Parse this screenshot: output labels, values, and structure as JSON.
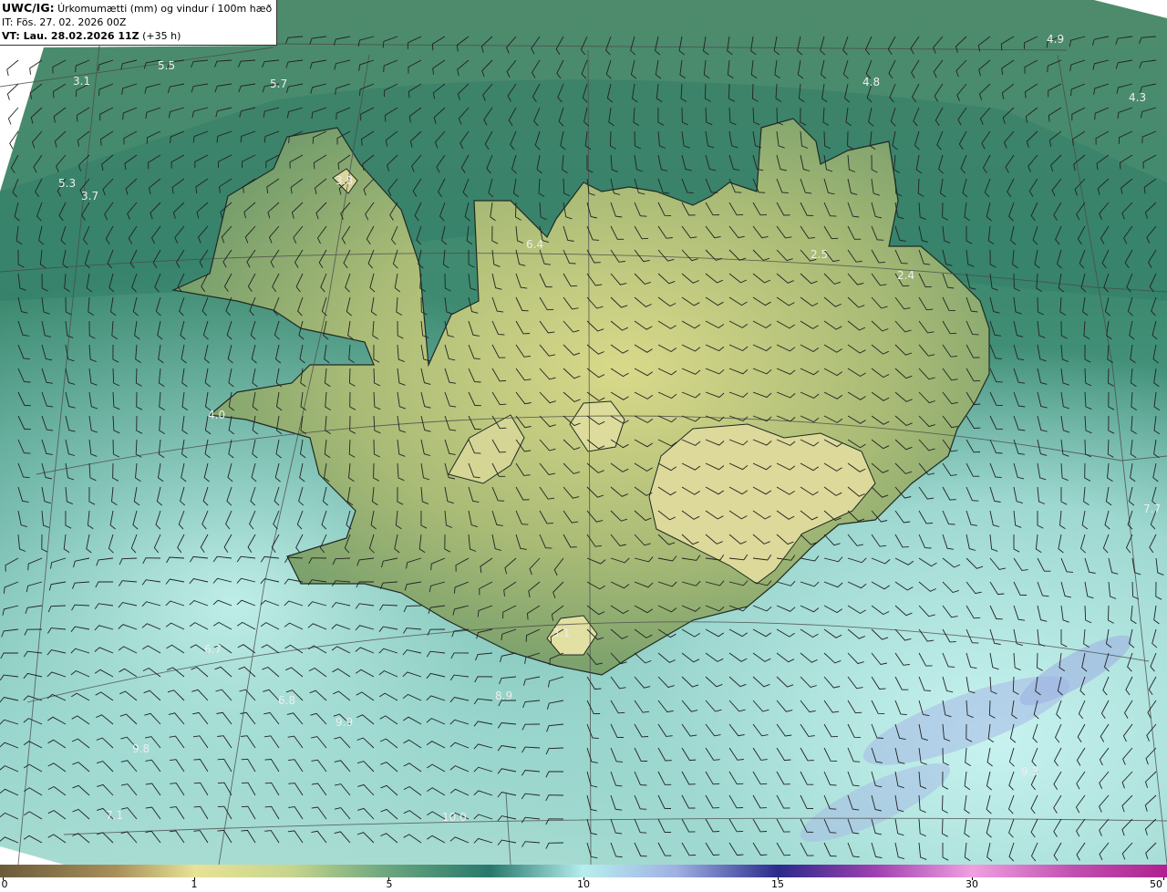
{
  "header": {
    "model": "UWC/IG:",
    "field": "Úrkomumætti (mm) og vindur í 100m hæð",
    "init_time": "IT: Fös. 27. 02. 2026 00Z",
    "valid_label": "VT: Lau. 28.02.2026 11Z",
    "lead": "(+35 h)"
  },
  "value_labels": [
    "3.1",
    "5.5",
    "5.7",
    "4.9",
    "4.8",
    "4.3",
    "5.3",
    "3.7",
    "3.8",
    "6.4",
    "2.5",
    "2.4",
    "4.0",
    "7.7",
    "6.7",
    "6.8",
    "8.9",
    "9.9",
    "9.8",
    "3.1",
    "7.1",
    "10.0",
    "9.3"
  ],
  "colorbar": {
    "ticks": [
      "0",
      "1",
      "5",
      "10",
      "15",
      "30",
      "50"
    ],
    "colors": [
      "#6b5a3a",
      "#a8905a",
      "#e8e295",
      "#6aa57f",
      "#27786b",
      "#b7eeee",
      "#c8f7f7",
      "#9fb0e3",
      "#2a2a8a",
      "#a040b0",
      "#f0a0e0",
      "#c050b0",
      "#b02090"
    ]
  }
}
